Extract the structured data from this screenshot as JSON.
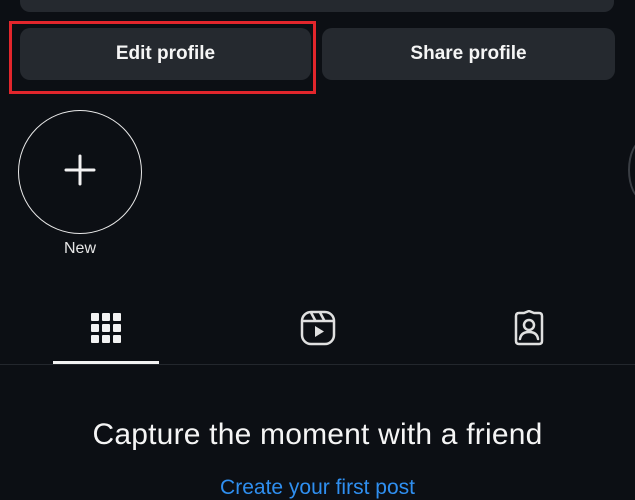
{
  "profile_actions": {
    "edit_label": "Edit profile",
    "share_label": "Share profile"
  },
  "highlights": {
    "new_label": "New",
    "new_icon": "plus-icon"
  },
  "tabs": [
    {
      "name": "grid",
      "icon": "grid-icon",
      "selected": true
    },
    {
      "name": "reels",
      "icon": "reels-icon",
      "selected": false
    },
    {
      "name": "tagged",
      "icon": "tagged-icon",
      "selected": false
    }
  ],
  "empty_state": {
    "title": "Capture the moment with a friend",
    "link": "Create your first post"
  },
  "colors": {
    "background": "#0c0f14",
    "button": "#25292f",
    "annotation_box": "#e2262c",
    "link": "#2f8ff0"
  }
}
